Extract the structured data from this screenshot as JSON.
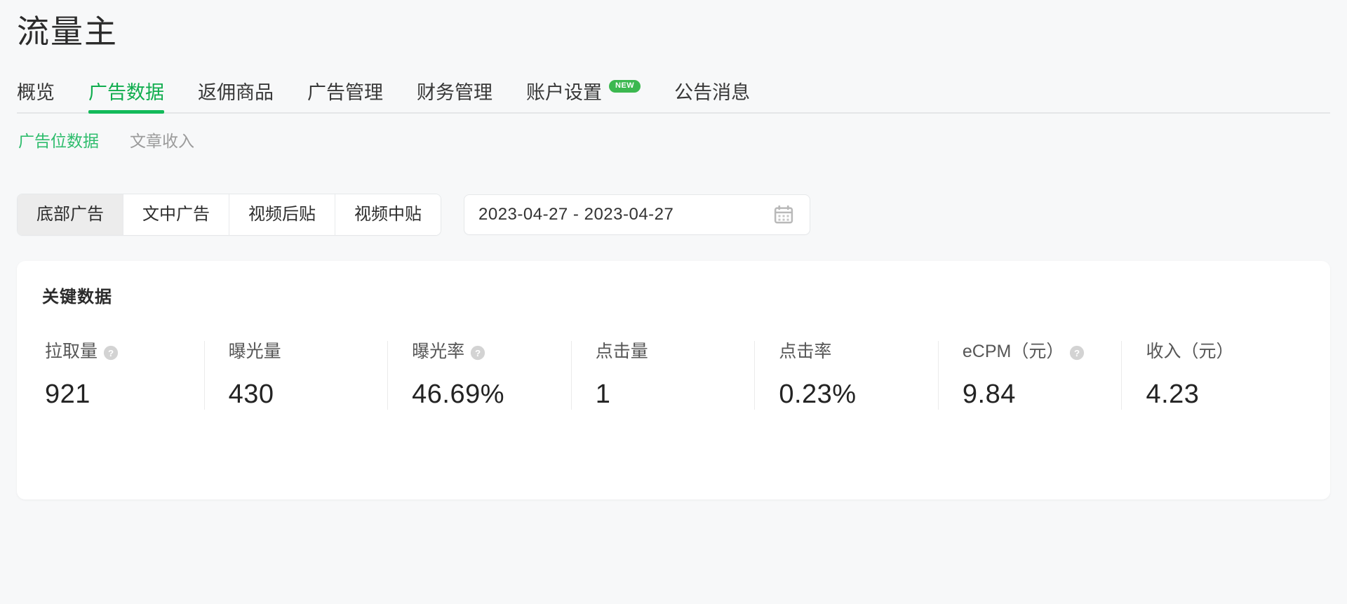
{
  "header": {
    "title": "流量主"
  },
  "tabs": [
    {
      "label": "概览",
      "active": false,
      "badge": null
    },
    {
      "label": "广告数据",
      "active": true,
      "badge": null
    },
    {
      "label": "返佣商品",
      "active": false,
      "badge": null
    },
    {
      "label": "广告管理",
      "active": false,
      "badge": null
    },
    {
      "label": "财务管理",
      "active": false,
      "badge": null
    },
    {
      "label": "账户设置",
      "active": false,
      "badge": "NEW"
    },
    {
      "label": "公告消息",
      "active": false,
      "badge": null
    }
  ],
  "subtabs": [
    {
      "label": "广告位数据",
      "active": true
    },
    {
      "label": "文章收入",
      "active": false
    }
  ],
  "filters": {
    "segments": [
      {
        "label": "底部广告",
        "selected": true
      },
      {
        "label": "文中广告",
        "selected": false
      },
      {
        "label": "视频后贴",
        "selected": false
      },
      {
        "label": "视频中贴",
        "selected": false
      }
    ],
    "date_range": "2023-04-27 - 2023-04-27",
    "calendar_icon": "calendar-icon"
  },
  "card": {
    "title": "关键数据",
    "metrics": [
      {
        "label": "拉取量",
        "value": "921",
        "help": true
      },
      {
        "label": "曝光量",
        "value": "430",
        "help": false
      },
      {
        "label": "曝光率",
        "value": "46.69%",
        "help": true
      },
      {
        "label": "点击量",
        "value": "1",
        "help": false
      },
      {
        "label": "点击率",
        "value": "0.23%",
        "help": false
      },
      {
        "label": "eCPM（元）",
        "value": "9.84",
        "help": true
      },
      {
        "label": "收入（元）",
        "value": "4.23",
        "help": false
      }
    ]
  },
  "colors": {
    "accent_green": "#13ba5a",
    "tab_active_text": "#10ad4e",
    "subtab_active": "#2fbd6d",
    "badge_green": "#3cb850",
    "page_bg": "#f7f8f9",
    "card_bg": "#ffffff"
  }
}
